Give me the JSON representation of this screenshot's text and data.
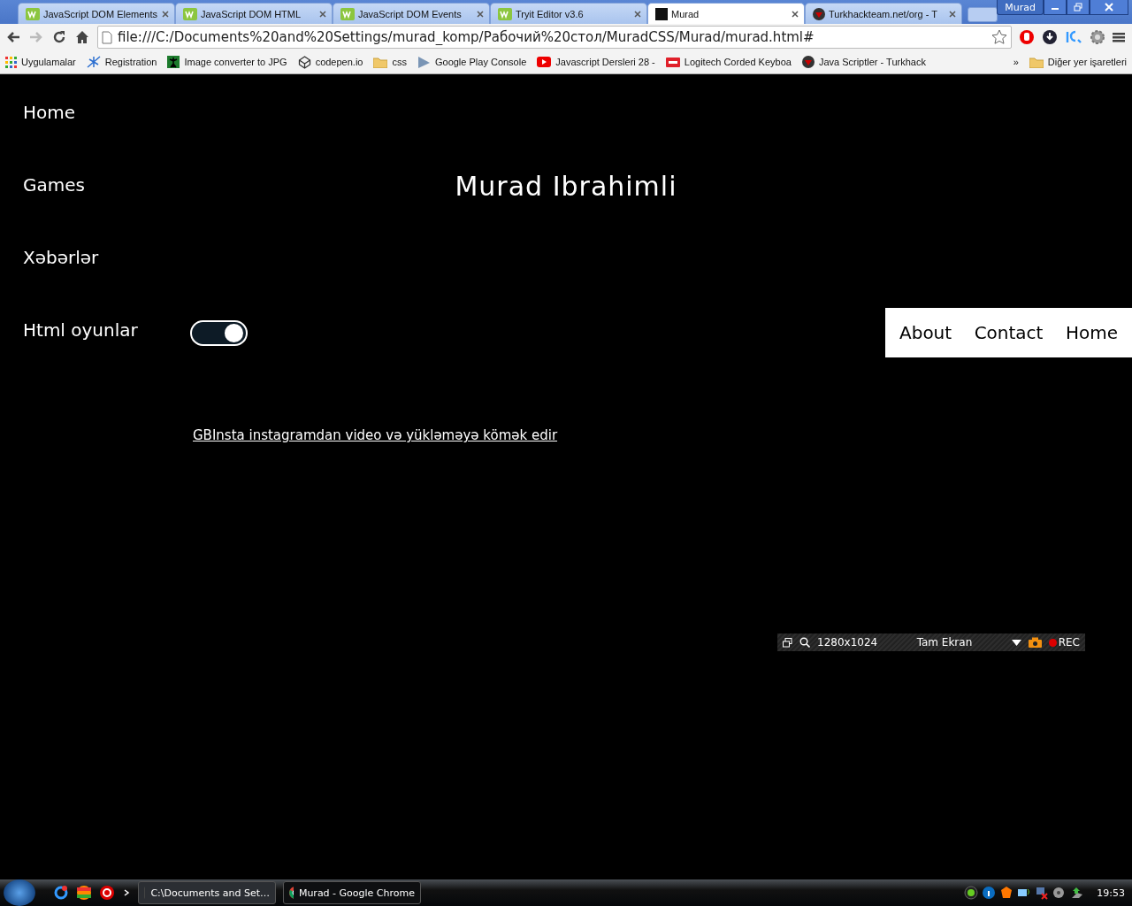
{
  "browser": {
    "tabs": [
      {
        "title": "JavaScript DOM Elements",
        "selected": false
      },
      {
        "title": "JavaScript DOM HTML",
        "selected": false
      },
      {
        "title": "JavaScript DOM Events",
        "selected": false
      },
      {
        "title": "Tryit Editor v3.6",
        "selected": false
      },
      {
        "title": "Murad",
        "selected": true
      },
      {
        "title": "Turkhackteam.net/org - T",
        "selected": false
      }
    ],
    "profile": "Murad",
    "address": "file:///C:/Documents%20and%20Settings/murad_komp/Рабочий%20стол/MuradCSS/Murad/murad.html#",
    "bookmarks": [
      "Uygulamalar",
      "Registration",
      "Image converter to JPG",
      "codepen.io",
      "css",
      "Google Play Console",
      "Javascript Dersleri 28 -",
      "Logitech Corded Keyboa",
      "Java Scriptler - Turkhack"
    ],
    "overflow": "»",
    "other_bookmarks": "Diğer yer işaretleri"
  },
  "page": {
    "sidebar": [
      "Home",
      "Games",
      "Xəbərlər",
      "Html oyunlar"
    ],
    "title": "Murad Ibrahimli",
    "toggle": {
      "on": true
    },
    "nav": [
      "About",
      "Contact",
      "Home"
    ],
    "link": "GBInsta instagramdan video və yükləməyə kömək edir"
  },
  "recorder": {
    "size": "1280x1024",
    "mode": "Tam Ekran",
    "rec": "REC"
  },
  "taskbar": {
    "windows": [
      {
        "label": "C:\\Documents and Set…",
        "selected": false
      },
      {
        "label": "Murad - Google Chrome",
        "selected": true
      }
    ],
    "clock": "19:53"
  }
}
